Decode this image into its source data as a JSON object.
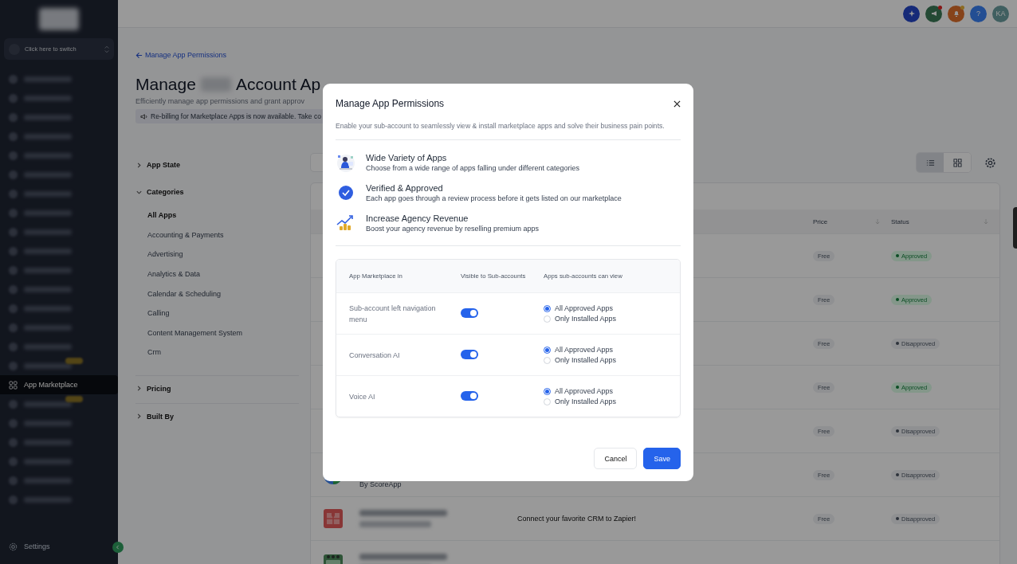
{
  "sidebar": {
    "switcher": {
      "label": "Click here to switch"
    },
    "nav_items": [
      {
        "kind": "redacted"
      },
      {
        "kind": "redacted"
      },
      {
        "kind": "redacted"
      },
      {
        "kind": "redacted"
      },
      {
        "kind": "redacted"
      },
      {
        "kind": "redacted"
      },
      {
        "kind": "redacted"
      },
      {
        "kind": "redacted"
      },
      {
        "kind": "redacted"
      },
      {
        "kind": "redacted"
      },
      {
        "kind": "redacted"
      },
      {
        "kind": "redacted"
      },
      {
        "kind": "redacted"
      },
      {
        "kind": "redacted"
      },
      {
        "kind": "redacted"
      },
      {
        "kind": "redacted_badge"
      },
      {
        "kind": "item",
        "label": "App Marketplace",
        "selected": true
      },
      {
        "kind": "redacted_badge"
      },
      {
        "kind": "redacted"
      },
      {
        "kind": "redacted"
      },
      {
        "kind": "redacted"
      },
      {
        "kind": "redacted"
      },
      {
        "kind": "redacted"
      }
    ],
    "settings": {
      "label": "Settings"
    }
  },
  "header": {
    "help": "?",
    "avatar": "KA"
  },
  "breadcrumb": "Manage App Permissions",
  "page_title": {
    "before": "Manage",
    "after": "Account Ap"
  },
  "subtitle": "Efficiently manage app permissions and grant approv",
  "banner": "Re-billing for Marketplace Apps is now available. Take co",
  "filters": [
    {
      "label": "App State",
      "expanded": false
    },
    {
      "label": "Categories",
      "expanded": true,
      "items": [
        {
          "label": "All Apps",
          "selected": true
        },
        {
          "label": "Accounting & Payments",
          "selected": false
        },
        {
          "label": "Advertising",
          "selected": false
        },
        {
          "label": "Analytics & Data",
          "selected": false
        },
        {
          "label": "Calendar & Scheduling",
          "selected": false
        },
        {
          "label": "Calling",
          "selected": false
        },
        {
          "label": "Content Management System",
          "selected": false
        },
        {
          "label": "Crm",
          "selected": false
        }
      ]
    },
    {
      "label": "Pricing",
      "expanded": false
    },
    {
      "label": "Built By",
      "expanded": false
    }
  ],
  "view_toggle": [
    {
      "kind": "list",
      "selected": true
    },
    {
      "kind": "grid",
      "selected": false
    }
  ],
  "table": {
    "columns": [
      "Price",
      "Status"
    ],
    "rows": [
      {
        "price": "Free",
        "status": "Approved",
        "approved": true
      },
      {
        "price": "Free",
        "status": "Approved",
        "approved": true
      },
      {
        "price": "Free",
        "status": "Disapproved",
        "approved": false
      },
      {
        "price": "Free",
        "status": "Approved",
        "approved": true
      },
      {
        "price": "Free",
        "status": "Disapproved",
        "approved": false
      },
      {
        "kind": "pie",
        "by": "By ScoreApp",
        "price": "Free",
        "status": "Disapproved",
        "approved": false
      },
      {
        "kind": "puzzle",
        "description": "Connect your favorite CRM to Zapier!",
        "price": "Free",
        "status": "Disapproved",
        "approved": false
      },
      {
        "kind": "board"
      }
    ]
  },
  "modal": {
    "title": "Manage App Permissions",
    "description": "Enable your sub-account to seamlessly view & install marketplace apps and solve their business pain points.",
    "features": [
      {
        "kind": "variety",
        "title": "Wide Variety of Apps",
        "text": "Choose from a wide range of apps falling under different categories"
      },
      {
        "kind": "verified",
        "title": "Verified & Approved",
        "text": "Each app goes through a review process before it gets listed on our marketplace"
      },
      {
        "kind": "revenue",
        "title": "Increase Agency Revenue",
        "text": "Boost your agency revenue by reselling premium apps"
      }
    ],
    "columns": [
      "App Marketplace in",
      "Visible to Sub-accounts",
      "Apps sub-accounts can view"
    ],
    "rows": [
      {
        "location": "Sub-account left navigation menu",
        "visible": true,
        "options": [
          {
            "label": "All Approved Apps",
            "selected": true
          },
          {
            "label": "Only Installed Apps",
            "selected": false
          }
        ]
      },
      {
        "location": "Conversation AI",
        "visible": true,
        "options": [
          {
            "label": "All Approved Apps",
            "selected": true
          },
          {
            "label": "Only Installed Apps",
            "selected": false
          }
        ]
      },
      {
        "location": "Voice AI",
        "visible": true,
        "options": [
          {
            "label": "All Approved Apps",
            "selected": true
          },
          {
            "label": "Only Installed Apps",
            "selected": false
          }
        ]
      }
    ],
    "buttons": [
      {
        "label": "Cancel",
        "kind": "secondary"
      },
      {
        "label": "Save",
        "kind": "primary"
      }
    ]
  }
}
